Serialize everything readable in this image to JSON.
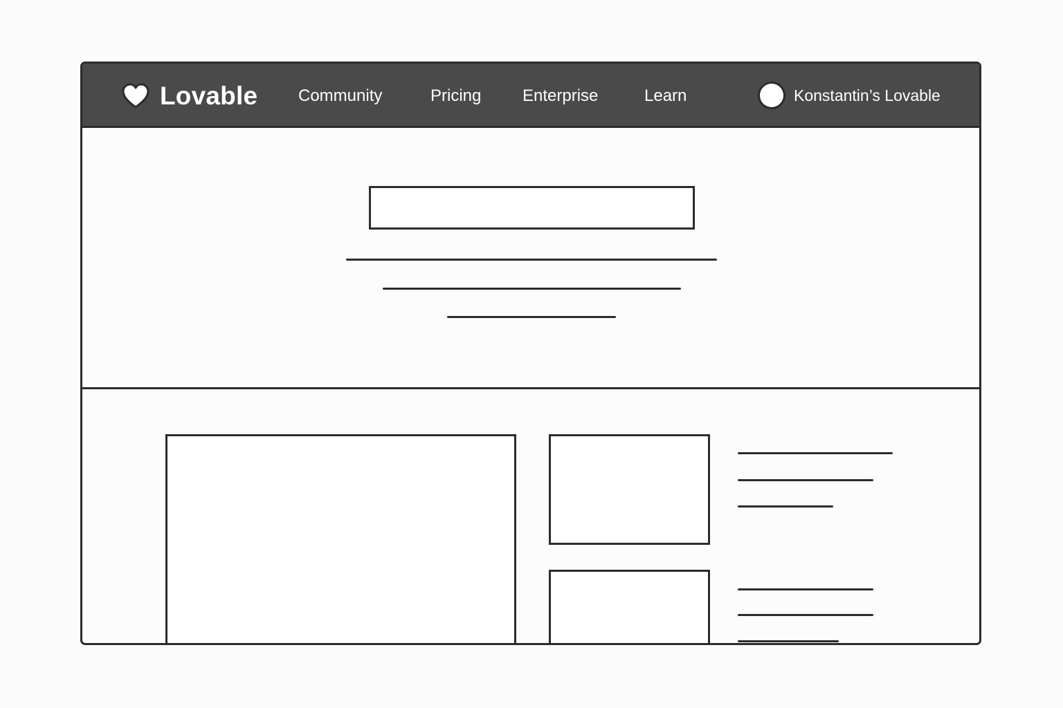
{
  "navbar": {
    "brand": {
      "name": "Lovable",
      "icon": "heart-icon"
    },
    "links": [
      {
        "label": "Community"
      },
      {
        "label": "Pricing"
      },
      {
        "label": "Enterprise"
      },
      {
        "label": "Learn"
      }
    ],
    "account": {
      "name": "Konstantin’s Lovable",
      "avatar_icon": "avatar-circle"
    }
  },
  "colors": {
    "nav_background": "#4a4a4a",
    "outline": "#2b2b2b",
    "page_background": "#fbfbfb",
    "text_on_nav": "#ffffff"
  }
}
